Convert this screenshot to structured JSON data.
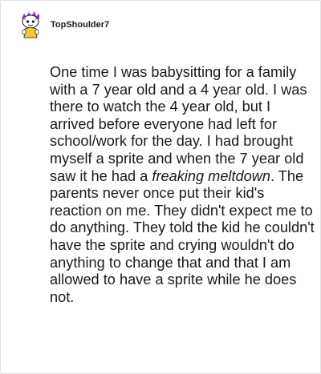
{
  "comment": {
    "username": "TopShoulder7",
    "avatar": {
      "icon": "reddit-snoo-avatar-icon",
      "hair_color": "#8e3fb0",
      "body_color": "#f2c83a"
    },
    "body": {
      "text_before": "One time I was babysitting for a family with a 7 year old and a 4 year old. I was there to watch the 4 year old, but I arrived before everyone had left for school/work for the day. I had brought myself a sprite and when the 7 year old saw it he had a ",
      "emphasis": "freaking meltdown",
      "text_after": ". The parents never once put their kid's reaction on me. They didn't expect me to do anything. They told the kid he couldn't have the sprite and crying wouldn't do anything to change that and that I am allowed to have a sprite while he does not."
    }
  }
}
